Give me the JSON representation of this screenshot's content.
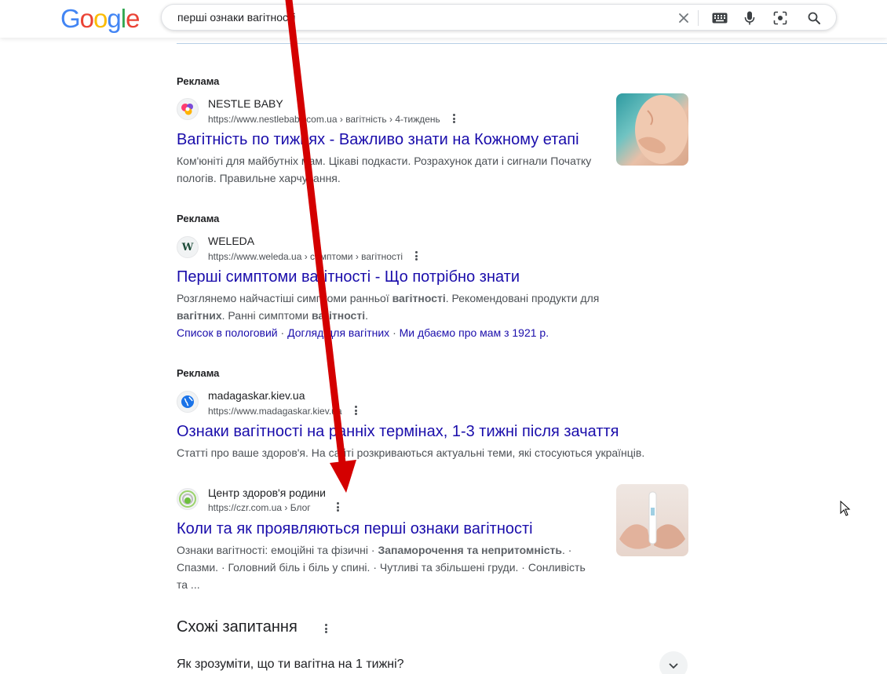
{
  "header": {
    "logo_letters": [
      "G",
      "o",
      "o",
      "g",
      "l",
      "e"
    ],
    "search_value": "перші ознаки вагітності",
    "icons": [
      "close-icon",
      "keyboard-icon",
      "microphone-icon",
      "lens-icon",
      "search-icon"
    ]
  },
  "results": [
    {
      "type": "ad",
      "ad_label": "Реклама",
      "site_name": "NESTLE BABY",
      "url": "https://www.nestlebaby.com.ua › вагітність › 4-тиждень",
      "title": "Вагітність по тижнях - Важливо знати на Кожному етапі",
      "snippet": "Ком'юніті для майбутніх мам. Цікаві подкасти. Розрахунок дати і сигнали Початку пологів. Правильне харчування."
    },
    {
      "type": "ad",
      "ad_label": "Реклама",
      "site_name": "WELEDA",
      "favicon_letter": "W",
      "url": "https://www.weleda.ua › симптоми › вагітності",
      "title": "Перші симптоми вагітності - Що потрібно знати",
      "snippet_parts": [
        {
          "t": "Розглянемо найчастіші симптоми ранньої ",
          "b": false
        },
        {
          "t": "вагітності",
          "b": true
        },
        {
          "t": ". Рекомендовані продукти для ",
          "b": false
        },
        {
          "t": "вагітних",
          "b": true
        },
        {
          "t": ". Ранні симптоми ",
          "b": false
        },
        {
          "t": "вагітності",
          "b": true
        },
        {
          "t": ".",
          "b": false
        }
      ],
      "sitelinks": [
        "Список в пологовий",
        "Догляд для вагітних",
        "Ми дбаємо про мам з 1921 р."
      ]
    },
    {
      "type": "ad",
      "ad_label": "Реклама",
      "site_name": "madagaskar.kiev.ua",
      "url": "https://www.madagaskar.kiev.ua",
      "title": "Ознаки вагітності на ранніх термінах, 1-3 тижні після зачаття",
      "snippet": "Статті про ваше здоров'я. На сайті розкриваються актуальні теми, які стосуються українців."
    },
    {
      "type": "organic",
      "site_name": "Центр здоров'я родини",
      "url": "https://czr.com.ua › Блог",
      "title": "Коли та як проявляються перші ознаки вагітності",
      "snippet_parts": [
        {
          "t": "Ознаки вагітності: емоційні та фізичні · ",
          "b": false
        },
        {
          "t": "Запаморочення та непритомність",
          "b": true
        },
        {
          "t": ". · Спазми. · Головний біль і біль у спині. · Чутливі та збільшені груди. · Сонливість та ...",
          "b": false
        }
      ]
    }
  ],
  "people_also_ask": {
    "title": "Схожі запитання",
    "questions": [
      "Як зрозуміти, що ти вагітна на 1 тижні?"
    ]
  },
  "colors": {
    "link": "#1a0dab",
    "annotation_arrow": "#d40000"
  }
}
